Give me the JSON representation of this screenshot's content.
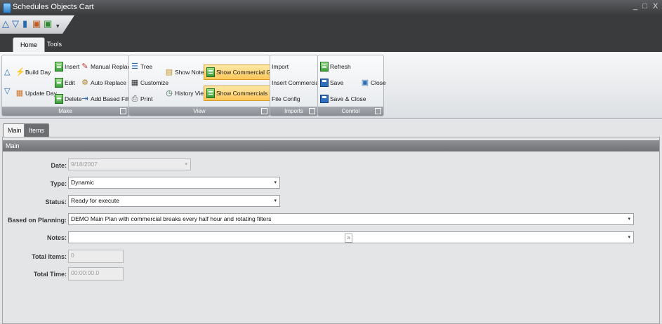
{
  "window": {
    "title": "Schedules Objects Cart",
    "controls": [
      "_",
      "□",
      "X"
    ]
  },
  "ribbon_tabs": [
    "Home",
    "Tools"
  ],
  "groups": {
    "make": {
      "label": "Make",
      "build_day": "Build Day",
      "update_day": "Update Day",
      "insert": "Insert",
      "edit": "Edit",
      "delete": "Delete",
      "manual_replace": "Manual Replace",
      "auto_replace": "Auto Replace",
      "add_based_filter": "Add Based Filter"
    },
    "view": {
      "label": "View",
      "tree": "Tree",
      "customize": "Customize",
      "print": "Print",
      "show_notes": "Show Notes",
      "history_view": "History View",
      "show_commercial_group": "Show Commercial Group",
      "show_commercials": "Show Commercials"
    },
    "imports": {
      "label": "Imports",
      "import": "Import",
      "insert_commercials": "Insert Commercials",
      "file_config": "File Config"
    },
    "control": {
      "label": "Conrtol",
      "refresh": "Refresh",
      "save": "Save",
      "save_close": "Save & Close",
      "close": "Close"
    }
  },
  "content_tabs": [
    "Main",
    "Items"
  ],
  "section": {
    "title": "Main"
  },
  "form": {
    "date": {
      "label": "Date:",
      "value": "9/18/2007"
    },
    "type": {
      "label": "Type:",
      "value": "Dynamic"
    },
    "status": {
      "label": "Status:",
      "value": "Ready for execute"
    },
    "based_on_planning": {
      "label": "Based on Planning:",
      "value": "DEMO Main Plan with commercial breaks every half hour and rotating filters"
    },
    "notes": {
      "label": "Notes:",
      "value": "",
      "marker": "a"
    },
    "total_items": {
      "label": "Total Items:",
      "value": "0"
    },
    "total_time": {
      "label": "Total Time:",
      "value": "00:00:00.0"
    }
  },
  "colors": {
    "accent_highlight": "#ffc75a",
    "dark_chrome": "#3a3b3d",
    "section_header": "#7e8084"
  }
}
